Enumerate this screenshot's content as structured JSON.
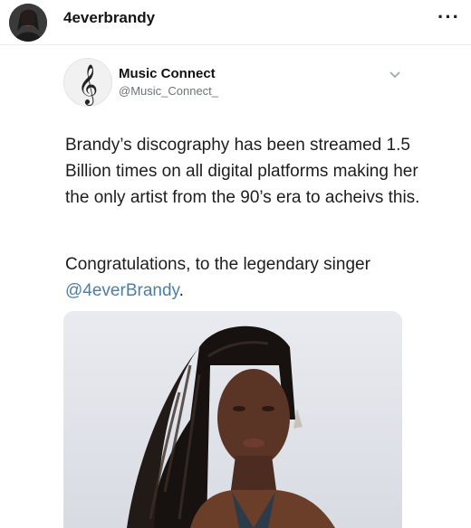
{
  "post": {
    "username": "4everbrandy",
    "more_label": "···"
  },
  "tweet": {
    "name": "Music Connect",
    "handle": "@Music_Connect_",
    "body_line1": "Brandy’s discography has been streamed 1.5 Billion times on all digital platforms making her the only artist from the 90’s era to acheivs this.",
    "body_line2_prefix": "Congratulations, to the legendary singer",
    "mention": "@4everBrandy",
    "mention_suffix": "."
  },
  "icons": {
    "post_avatar": "profile-avatar",
    "tweet_avatar": "treble-clef-icon",
    "tweet_menu": "chevron-down-icon",
    "more": "more-horizontal-icon"
  },
  "colors": {
    "mention": "#4f7da3",
    "handle": "#6f7378"
  }
}
